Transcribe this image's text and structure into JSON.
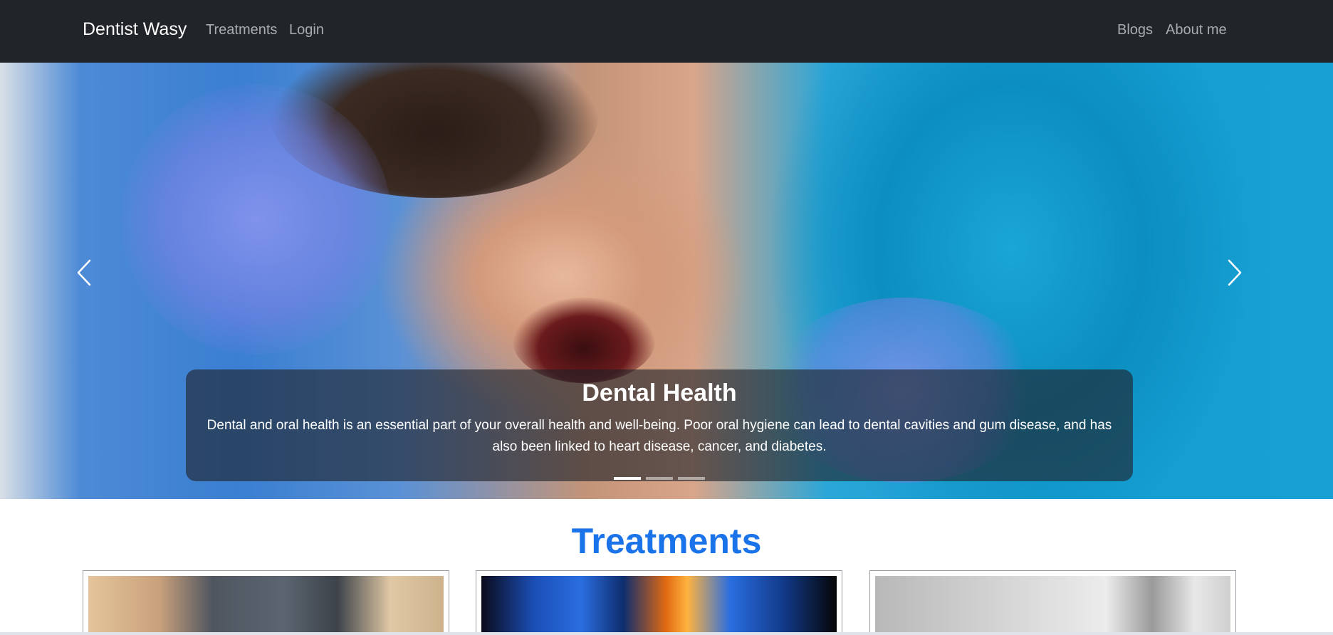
{
  "navbar": {
    "brand": "Dentist Wasy",
    "left_links": [
      "Treatments",
      "Login"
    ],
    "right_links": [
      "Blogs",
      "About me"
    ],
    "background": "#212529"
  },
  "carousel": {
    "caption_title": "Dental Health",
    "caption_text": "Dental and oral health is an essential part of your overall health and well-being. Poor oral hygiene can lead to dental cavities and gum disease, and has also been linked to heart disease, cancer, and diabetes.",
    "slide_count": 3,
    "active_slide": 1,
    "prev_icon": "chevron-left-icon",
    "next_icon": "chevron-right-icon"
  },
  "treatments": {
    "title": "Treatments",
    "title_color": "#1a73e8",
    "cards": [
      {
        "image": "dental-implant-photo"
      },
      {
        "image": "teeth-xray-illustration"
      },
      {
        "image": "dental-drill-photo"
      }
    ]
  }
}
